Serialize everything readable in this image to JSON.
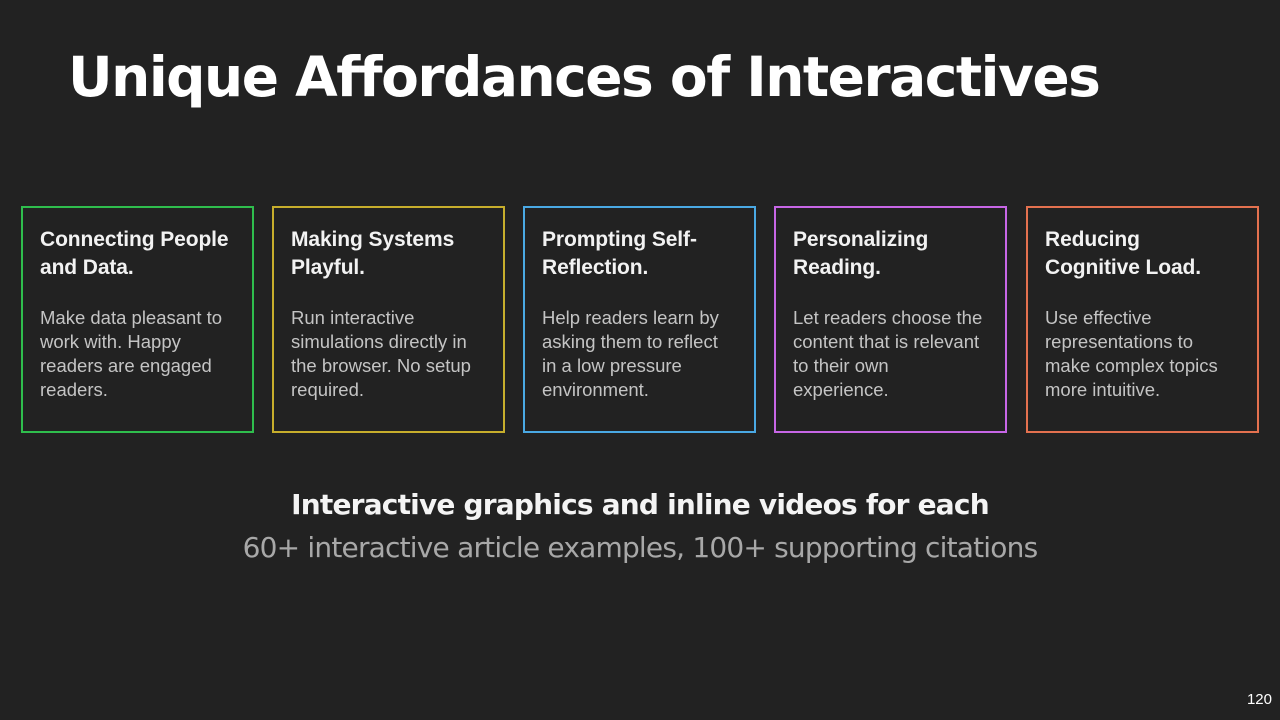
{
  "slide": {
    "title": "Unique Affordances of Interactives",
    "cards": [
      {
        "title": "Connecting People and Data.",
        "body": "Make data pleasant to work with. Happy readers are engaged readers.",
        "border_color": "#2fbe4d"
      },
      {
        "title": "Making Systems Playful.",
        "body": "Run interactive simulations directly in the browser. No setup required.",
        "border_color": "#c7ae2c"
      },
      {
        "title": "Prompting Self-Reflection.",
        "body": "Help readers learn by asking them to reflect in a low pressure environment.",
        "border_color": "#4aa9e4"
      },
      {
        "title": "Personalizing Reading.",
        "body": "Let readers choose the content that is relevant to their own experience.",
        "border_color": "#c766e6"
      },
      {
        "title": "Reducing Cognitive Load.",
        "body": "Use effective representations to make complex topics more intuitive.",
        "border_color": "#e4714f"
      }
    ],
    "subtitle": "Interactive graphics and inline videos for each",
    "stats": "60+ interactive article examples, 100+ supporting citations",
    "page_number": "120"
  }
}
